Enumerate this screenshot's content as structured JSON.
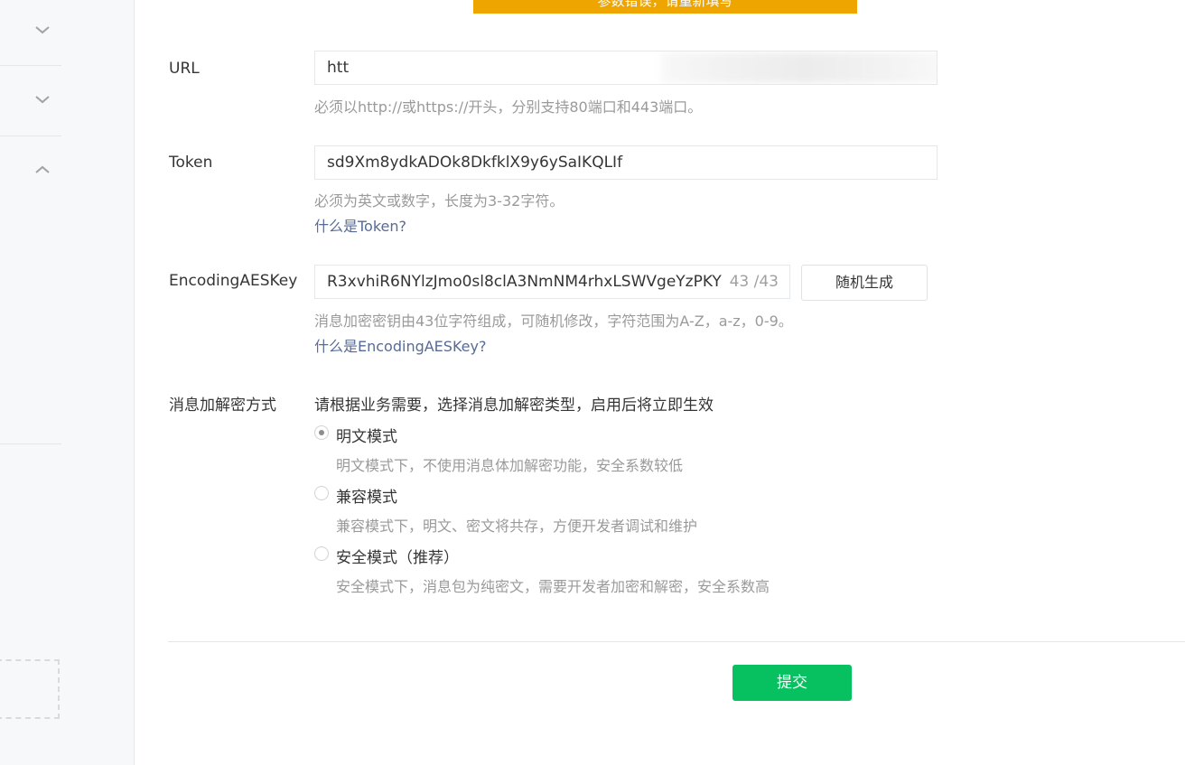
{
  "sidebar": {
    "chevrons": [
      "chevron-down-icon",
      "chevron-down-icon",
      "chevron-up-icon"
    ]
  },
  "banner": {
    "text": "参数错误，请重新填写",
    "color": "#eea500"
  },
  "form": {
    "url": {
      "label": "URL",
      "value": "htt",
      "hint": "必须以http://或https://开头，分别支持80端口和443端口。"
    },
    "token": {
      "label": "Token",
      "value": "sd9Xm8ydkADOk8DkfklX9y6ySaIKQLIf",
      "hint": "必须为英文或数字，长度为3-32字符。",
      "link": "什么是Token?"
    },
    "aeskey": {
      "label": "EncodingAESKey",
      "value": "R3xvhiR6NYlzJmo0sl8clA3NmNM4rhxLSWVgeYzPKY",
      "count": "43 /43",
      "random_button": "随机生成",
      "hint": "消息加密密钥由43位字符组成，可随机修改，字符范围为A-Z，a-z，0-9。",
      "link": "什么是EncodingAESKey?"
    },
    "encryption": {
      "label": "消息加解密方式",
      "desc": "请根据业务需要，选择消息加解密类型，启用后将立即生效",
      "options": [
        {
          "label": "明文模式",
          "hint": "明文模式下，不使用消息体加解密功能，安全系数较低",
          "checked": true
        },
        {
          "label": "兼容模式",
          "hint": "兼容模式下，明文、密文将共存，方便开发者调试和维护",
          "checked": false
        },
        {
          "label": "安全模式（推荐）",
          "hint": "安全模式下，消息包为纯密文，需要开发者加密和解密，安全系数高",
          "checked": false
        }
      ]
    }
  },
  "submit_label": "提交",
  "colors": {
    "submit": "#07c160",
    "link": "#576b95",
    "hint": "#9a9a9a"
  }
}
